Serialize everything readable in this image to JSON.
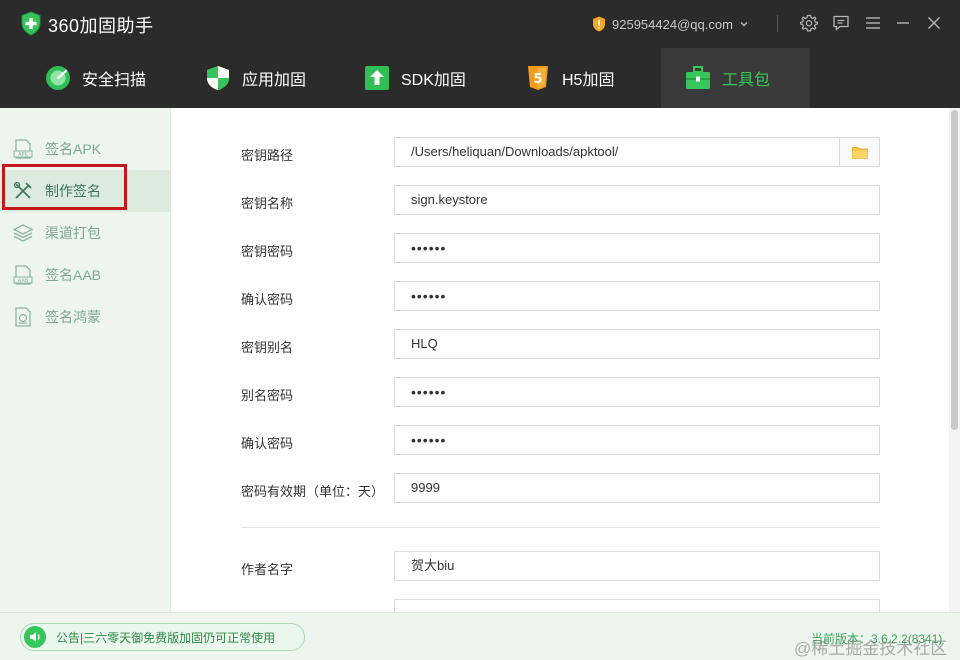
{
  "app": {
    "title": "360加固助手"
  },
  "titlebar": {
    "account": "925954424@qq.com"
  },
  "tabs": [
    {
      "label": "安全扫描",
      "icon": "scan-icon"
    },
    {
      "label": "应用加固",
      "icon": "shield-icon"
    },
    {
      "label": "SDK加固",
      "icon": "sdk-upload-icon"
    },
    {
      "label": "H5加固",
      "icon": "html5-icon"
    },
    {
      "label": "工具包",
      "icon": "toolbox-icon",
      "active": true
    }
  ],
  "sidebar": {
    "items": [
      {
        "label": "签名APK",
        "icon": "apk-file-icon"
      },
      {
        "label": "制作签名",
        "icon": "tools-icon",
        "active": true
      },
      {
        "label": "渠道打包",
        "icon": "layers-icon"
      },
      {
        "label": "签名AAB",
        "icon": "aab-file-icon"
      },
      {
        "label": "签名鸿蒙",
        "icon": "harmony-file-icon"
      }
    ]
  },
  "form": {
    "keystore_path": {
      "label": "密钥路径",
      "value": "/Users/heliquan/Downloads/apktool/"
    },
    "keystore_name": {
      "label": "密钥名称",
      "value": "sign.keystore"
    },
    "keystore_password": {
      "label": "密钥密码",
      "value": "••••••"
    },
    "confirm_password": {
      "label": "确认密码",
      "value": "••••••"
    },
    "alias": {
      "label": "密钥别名",
      "value": "HLQ"
    },
    "alias_password": {
      "label": "别名密码",
      "value": "••••••"
    },
    "confirm_alias_password": {
      "label": "确认密码",
      "value": "••••••"
    },
    "validity": {
      "label": "密码有效期（单位：天）",
      "value": "9999"
    },
    "author": {
      "label": "作者名字",
      "value": "贺大biu"
    }
  },
  "statusbar": {
    "notice": "公告|三六零天御免费版加固仍可正常使用",
    "version": "当前版本：3.6.2.2(8341)",
    "watermark": "@稀土掘金技术社区"
  },
  "colors": {
    "accent": "#35c75a",
    "titlebar": "#2b2b2b",
    "highlight": "#c4161c"
  }
}
